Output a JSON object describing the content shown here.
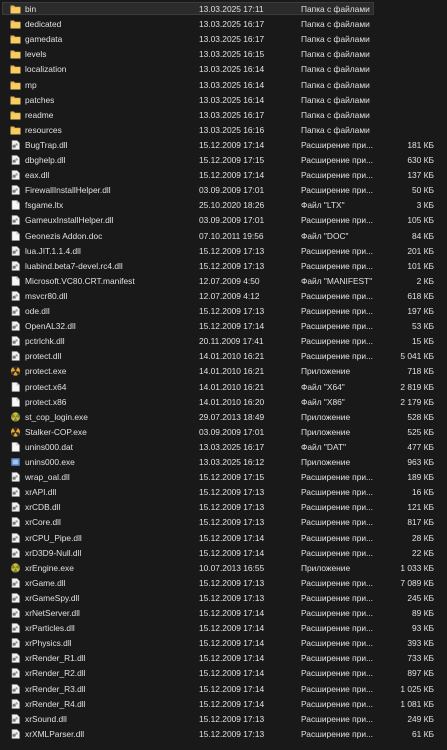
{
  "files": [
    {
      "name": "bin",
      "date": "13.03.2025 17:11",
      "type": "Папка с файлами",
      "size": "",
      "icon": "folder-icon",
      "selected": true
    },
    {
      "name": "dedicated",
      "date": "13.03.2025 16:17",
      "type": "Папка с файлами",
      "size": "",
      "icon": "folder-icon"
    },
    {
      "name": "gamedata",
      "date": "13.03.2025 16:17",
      "type": "Папка с файлами",
      "size": "",
      "icon": "folder-icon"
    },
    {
      "name": "levels",
      "date": "13.03.2025 16:15",
      "type": "Папка с файлами",
      "size": "",
      "icon": "folder-icon"
    },
    {
      "name": "localization",
      "date": "13.03.2025 16:14",
      "type": "Папка с файлами",
      "size": "",
      "icon": "folder-icon"
    },
    {
      "name": "mp",
      "date": "13.03.2025 16:14",
      "type": "Папка с файлами",
      "size": "",
      "icon": "folder-icon"
    },
    {
      "name": "patches",
      "date": "13.03.2025 16:14",
      "type": "Папка с файлами",
      "size": "",
      "icon": "folder-icon"
    },
    {
      "name": "readme",
      "date": "13.03.2025 16:17",
      "type": "Папка с файлами",
      "size": "",
      "icon": "folder-icon"
    },
    {
      "name": "resources",
      "date": "13.03.2025 16:16",
      "type": "Папка с файлами",
      "size": "",
      "icon": "folder-icon"
    },
    {
      "name": "BugTrap.dll",
      "date": "15.12.2009 17:14",
      "type": "Расширение при...",
      "size": "181 КБ",
      "icon": "dll-file-icon"
    },
    {
      "name": "dbghelp.dll",
      "date": "15.12.2009 17:15",
      "type": "Расширение при...",
      "size": "630 КБ",
      "icon": "dll-file-icon"
    },
    {
      "name": "eax.dll",
      "date": "15.12.2009 17:14",
      "type": "Расширение при...",
      "size": "137 КБ",
      "icon": "dll-file-icon"
    },
    {
      "name": "FirewallInstallHelper.dll",
      "date": "03.09.2009 17:01",
      "type": "Расширение при...",
      "size": "50 КБ",
      "icon": "dll-file-icon"
    },
    {
      "name": "fsgame.ltx",
      "date": "25.10.2020 18:26",
      "type": "Файл \"LTX\"",
      "size": "3 КБ",
      "icon": "blank-file-icon"
    },
    {
      "name": "GameuxInstallHelper.dll",
      "date": "03.09.2009 17:01",
      "type": "Расширение при...",
      "size": "105 КБ",
      "icon": "dll-file-icon"
    },
    {
      "name": "Geonezis Addon.doc",
      "date": "07.10.2011 19:56",
      "type": "Файл \"DOC\"",
      "size": "84 КБ",
      "icon": "blank-file-icon"
    },
    {
      "name": "lua.JIT.1.1.4.dll",
      "date": "15.12.2009 17:13",
      "type": "Расширение при...",
      "size": "201 КБ",
      "icon": "dll-file-icon"
    },
    {
      "name": "luabind.beta7-devel.rc4.dll",
      "date": "15.12.2009 17:13",
      "type": "Расширение при...",
      "size": "101 КБ",
      "icon": "dll-file-icon"
    },
    {
      "name": "Microsoft.VC80.CRT.manifest",
      "date": "12.07.2009 4:50",
      "type": "Файл \"MANIFEST\"",
      "size": "2 КБ",
      "icon": "blank-file-icon"
    },
    {
      "name": "msvcr80.dll",
      "date": "12.07.2009 4:12",
      "type": "Расширение при...",
      "size": "618 КБ",
      "icon": "dll-file-icon"
    },
    {
      "name": "ode.dll",
      "date": "15.12.2009 17:13",
      "type": "Расширение при...",
      "size": "197 КБ",
      "icon": "dll-file-icon"
    },
    {
      "name": "OpenAL32.dll",
      "date": "15.12.2009 17:14",
      "type": "Расширение при...",
      "size": "53 КБ",
      "icon": "dll-file-icon"
    },
    {
      "name": "pctrlchk.dll",
      "date": "20.11.2009 17:41",
      "type": "Расширение при...",
      "size": "15 КБ",
      "icon": "dll-file-icon"
    },
    {
      "name": "protect.dll",
      "date": "14.01.2010 16:21",
      "type": "Расширение при...",
      "size": "5 041 КБ",
      "icon": "dll-file-icon"
    },
    {
      "name": "protect.exe",
      "date": "14.01.2010 16:21",
      "type": "Приложение",
      "size": "718 КБ",
      "icon": "radiation-exe-icon"
    },
    {
      "name": "protect.x64",
      "date": "14.01.2010 16:21",
      "type": "Файл \"X64\"",
      "size": "2 819 КБ",
      "icon": "blank-file-icon"
    },
    {
      "name": "protect.x86",
      "date": "14.01.2010 16:20",
      "type": "Файл \"X86\"",
      "size": "2 179 КБ",
      "icon": "blank-file-icon"
    },
    {
      "name": "st_cop_login.exe",
      "date": "29.07.2013 18:49",
      "type": "Приложение",
      "size": "528 КБ",
      "icon": "green-exe-icon"
    },
    {
      "name": "Stalker-COP.exe",
      "date": "03.09.2009 17:01",
      "type": "Приложение",
      "size": "525 КБ",
      "icon": "radiation-exe-icon"
    },
    {
      "name": "unins000.dat",
      "date": "13.03.2025 16:17",
      "type": "Файл \"DAT\"",
      "size": "477 КБ",
      "icon": "blank-file-icon"
    },
    {
      "name": "unins000.exe",
      "date": "13.03.2025 16:12",
      "type": "Приложение",
      "size": "963 КБ",
      "icon": "installer-exe-icon"
    },
    {
      "name": "wrap_oal.dll",
      "date": "15.12.2009 17:15",
      "type": "Расширение при...",
      "size": "189 КБ",
      "icon": "dll-file-icon"
    },
    {
      "name": "xrAPI.dll",
      "date": "15.12.2009 17:13",
      "type": "Расширение при...",
      "size": "16 КБ",
      "icon": "dll-file-icon"
    },
    {
      "name": "xrCDB.dll",
      "date": "15.12.2009 17:13",
      "type": "Расширение при...",
      "size": "121 КБ",
      "icon": "dll-file-icon"
    },
    {
      "name": "xrCore.dll",
      "date": "15.12.2009 17:13",
      "type": "Расширение при...",
      "size": "817 КБ",
      "icon": "dll-file-icon"
    },
    {
      "name": "xrCPU_Pipe.dll",
      "date": "15.12.2009 17:14",
      "type": "Расширение при...",
      "size": "28 КБ",
      "icon": "dll-file-icon"
    },
    {
      "name": "xrD3D9-Null.dll",
      "date": "15.12.2009 17:14",
      "type": "Расширение при...",
      "size": "22 КБ",
      "icon": "dll-file-icon"
    },
    {
      "name": "xrEngine.exe",
      "date": "10.07.2013 16:55",
      "type": "Приложение",
      "size": "1 033 КБ",
      "icon": "green-exe-icon"
    },
    {
      "name": "xrGame.dll",
      "date": "15.12.2009 17:13",
      "type": "Расширение при...",
      "size": "7 089 КБ",
      "icon": "dll-file-icon"
    },
    {
      "name": "xrGameSpy.dll",
      "date": "15.12.2009 17:13",
      "type": "Расширение при...",
      "size": "245 КБ",
      "icon": "dll-file-icon"
    },
    {
      "name": "xrNetServer.dll",
      "date": "15.12.2009 17:14",
      "type": "Расширение при...",
      "size": "89 КБ",
      "icon": "dll-file-icon"
    },
    {
      "name": "xrParticles.dll",
      "date": "15.12.2009 17:14",
      "type": "Расширение при...",
      "size": "93 КБ",
      "icon": "dll-file-icon"
    },
    {
      "name": "xrPhysics.dll",
      "date": "15.12.2009 17:14",
      "type": "Расширение при...",
      "size": "393 КБ",
      "icon": "dll-file-icon"
    },
    {
      "name": "xrRender_R1.dll",
      "date": "15.12.2009 17:14",
      "type": "Расширение при...",
      "size": "733 КБ",
      "icon": "dll-file-icon"
    },
    {
      "name": "xrRender_R2.dll",
      "date": "15.12.2009 17:14",
      "type": "Расширение при...",
      "size": "897 КБ",
      "icon": "dll-file-icon"
    },
    {
      "name": "xrRender_R3.dll",
      "date": "15.12.2009 17:14",
      "type": "Расширение при...",
      "size": "1 025 КБ",
      "icon": "dll-file-icon"
    },
    {
      "name": "xrRender_R4.dll",
      "date": "15.12.2009 17:14",
      "type": "Расширение при...",
      "size": "1 081 КБ",
      "icon": "dll-file-icon"
    },
    {
      "name": "xrSound.dll",
      "date": "15.12.2009 17:13",
      "type": "Расширение при...",
      "size": "249 КБ",
      "icon": "dll-file-icon"
    },
    {
      "name": "xrXMLParser.dll",
      "date": "15.12.2009 17:13",
      "type": "Расширение при...",
      "size": "61 КБ",
      "icon": "dll-file-icon"
    }
  ]
}
